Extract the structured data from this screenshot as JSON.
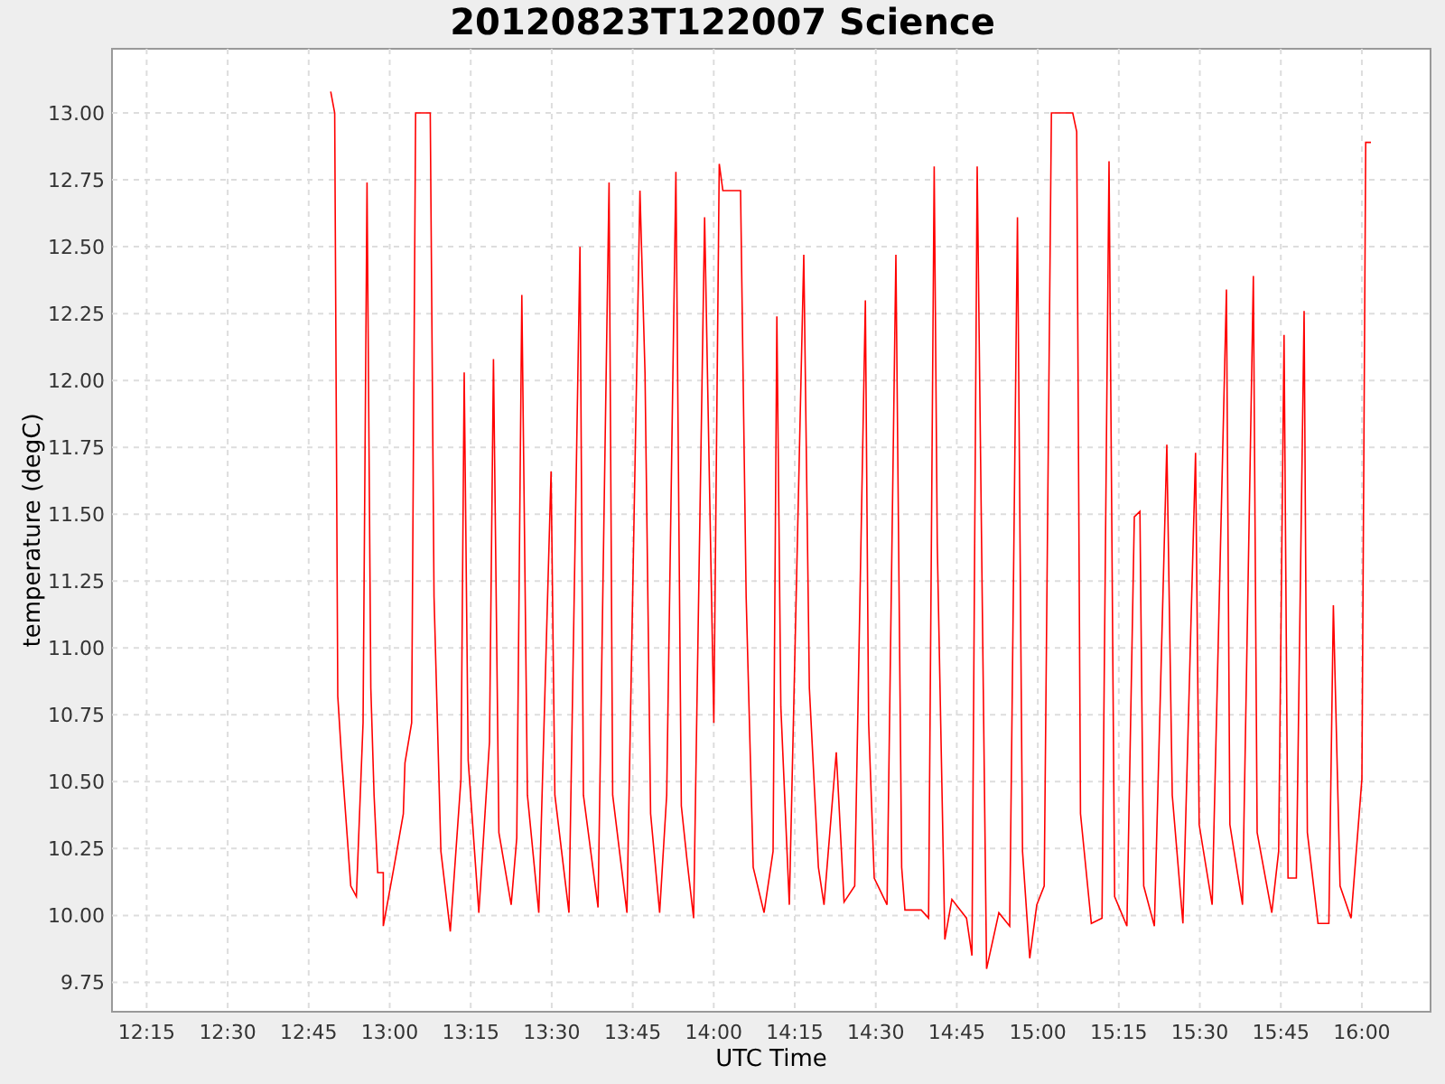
{
  "chart": {
    "chart_data": {
      "type": "line",
      "title": "20120823T122007 Science",
      "xlabel": "UTC Time",
      "ylabel": "temperature (degC)",
      "x": [
        12.818,
        12.83,
        12.84,
        12.852,
        12.88,
        12.897,
        12.918,
        12.93,
        12.942,
        12.952,
        12.963,
        12.98,
        12.98,
        13.013,
        13.042,
        13.047,
        13.068,
        13.08,
        13.125,
        13.137,
        13.158,
        13.187,
        13.22,
        13.23,
        13.242,
        13.275,
        13.308,
        13.32,
        13.337,
        13.375,
        13.392,
        13.408,
        13.425,
        13.46,
        13.498,
        13.51,
        13.553,
        13.587,
        13.598,
        13.643,
        13.677,
        13.688,
        13.732,
        13.772,
        13.788,
        13.805,
        13.833,
        13.855,
        13.883,
        13.9,
        13.917,
        13.938,
        13.972,
        14.0,
        14.017,
        14.028,
        14.083,
        14.1,
        14.122,
        14.155,
        14.183,
        14.195,
        14.207,
        14.233,
        14.278,
        14.295,
        14.323,
        14.34,
        14.378,
        14.402,
        14.435,
        14.468,
        14.478,
        14.495,
        14.535,
        14.562,
        14.58,
        14.59,
        14.64,
        14.663,
        14.68,
        14.69,
        14.713,
        14.735,
        14.78,
        14.797,
        14.813,
        14.825,
        14.842,
        14.88,
        14.913,
        14.937,
        14.953,
        14.975,
        14.997,
        15.02,
        15.042,
        15.108,
        15.12,
        15.132,
        15.165,
        15.198,
        15.22,
        15.237,
        15.275,
        15.298,
        15.315,
        15.327,
        15.36,
        15.398,
        15.415,
        15.448,
        15.487,
        15.498,
        15.538,
        15.582,
        15.593,
        15.632,
        15.665,
        15.677,
        15.722,
        15.743,
        15.76,
        15.772,
        15.798,
        15.822,
        15.832,
        15.865,
        15.898,
        15.912,
        15.933,
        15.967,
        16.0,
        16.012,
        16.028
      ],
      "series": [
        {
          "color": "#ff0000",
          "values": [
            13.08,
            13.0,
            10.82,
            10.58,
            10.11,
            10.07,
            10.72,
            12.74,
            10.85,
            10.45,
            10.16,
            10.16,
            9.96,
            10.18,
            10.38,
            10.57,
            10.72,
            13.0,
            13.0,
            11.19,
            10.24,
            9.94,
            10.51,
            12.03,
            10.58,
            10.01,
            10.65,
            12.08,
            10.31,
            10.04,
            10.29,
            12.32,
            10.45,
            10.01,
            11.66,
            10.45,
            10.01,
            12.5,
            10.45,
            10.03,
            12.74,
            10.45,
            10.01,
            12.71,
            12.03,
            10.38,
            10.01,
            10.45,
            12.78,
            10.41,
            10.21,
            9.99,
            12.61,
            10.72,
            12.81,
            12.71,
            12.71,
            11.19,
            10.18,
            10.01,
            10.24,
            12.24,
            10.78,
            10.04,
            12.47,
            10.85,
            10.18,
            10.04,
            10.61,
            10.05,
            10.11,
            12.3,
            10.72,
            10.14,
            10.04,
            12.47,
            10.18,
            10.02,
            10.02,
            9.99,
            12.8,
            11.39,
            9.91,
            10.06,
            9.99,
            9.85,
            12.8,
            11.53,
            9.8,
            10.01,
            9.96,
            12.61,
            10.24,
            9.84,
            10.04,
            10.11,
            13.0,
            13.0,
            12.93,
            10.38,
            9.97,
            9.99,
            12.82,
            10.07,
            9.96,
            11.49,
            11.51,
            10.11,
            9.96,
            11.76,
            10.45,
            9.97,
            11.73,
            10.34,
            10.04,
            12.34,
            10.34,
            10.04,
            12.39,
            10.31,
            10.01,
            10.24,
            12.17,
            10.14,
            10.14,
            12.26,
            10.31,
            9.97,
            9.97,
            11.16,
            10.11,
            9.99,
            10.51,
            12.89,
            12.89
          ]
        }
      ],
      "grid": true,
      "xlim": [
        12.143,
        16.212
      ],
      "ylim": [
        9.64,
        13.24
      ],
      "xticks": [
        {
          "value": 12.25,
          "label": "12:15"
        },
        {
          "value": 12.5,
          "label": "12:30"
        },
        {
          "value": 12.75,
          "label": "12:45"
        },
        {
          "value": 13,
          "label": "13:00"
        },
        {
          "value": 13.25,
          "label": "13:15"
        },
        {
          "value": 13.5,
          "label": "13:30"
        },
        {
          "value": 13.75,
          "label": "13:45"
        },
        {
          "value": 14,
          "label": "14:00"
        },
        {
          "value": 14.25,
          "label": "14:15"
        },
        {
          "value": 14.5,
          "label": "14:30"
        },
        {
          "value": 14.75,
          "label": "14:45"
        },
        {
          "value": 15,
          "label": "15:00"
        },
        {
          "value": 15.25,
          "label": "15:15"
        },
        {
          "value": 15.5,
          "label": "15:30"
        },
        {
          "value": 15.75,
          "label": "15:45"
        },
        {
          "value": 16,
          "label": "16:00"
        }
      ],
      "yticks": [
        {
          "value": 9.75,
          "label": "9.75"
        },
        {
          "value": 10,
          "label": "10.00"
        },
        {
          "value": 10.25,
          "label": "10.25"
        },
        {
          "value": 10.5,
          "label": "10.50"
        },
        {
          "value": 10.75,
          "label": "10.75"
        },
        {
          "value": 11,
          "label": "11.00"
        },
        {
          "value": 11.25,
          "label": "11.25"
        },
        {
          "value": 11.5,
          "label": "11.50"
        },
        {
          "value": 11.75,
          "label": "11.75"
        },
        {
          "value": 12,
          "label": "12.00"
        },
        {
          "value": 12.25,
          "label": "12.25"
        },
        {
          "value": 12.5,
          "label": "12.50"
        },
        {
          "value": 12.75,
          "label": "12.75"
        },
        {
          "value": 13,
          "label": "13.00"
        }
      ]
    }
  }
}
